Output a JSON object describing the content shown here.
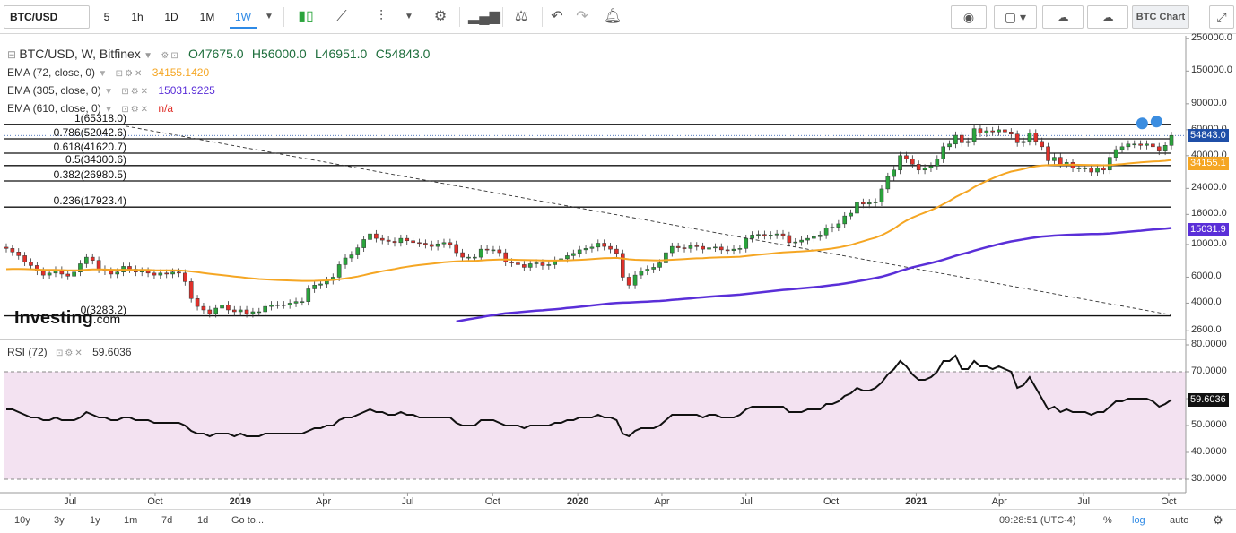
{
  "toolbar": {
    "symbol": "BTC/USD",
    "intervals": [
      "5",
      "1h",
      "1D",
      "1M",
      "1W"
    ],
    "active_interval": "1W",
    "chart_button": "BTC Chart"
  },
  "legend": {
    "title": "BTC/USD, W, Bitfinex",
    "open": "O47675.0",
    "high": "H56000.0",
    "low": "L46951.0",
    "close": "C54843.0",
    "ema72": {
      "label": "EMA (72, close, 0)",
      "value": "34155.1420",
      "color": "#f5a623"
    },
    "ema305": {
      "label": "EMA (305, close, 0)",
      "value": "15031.9225",
      "color": "#5a2fd8"
    },
    "ema610": {
      "label": "EMA (610, close, 0)",
      "value": "n/a",
      "color": "#e0302a"
    },
    "rsi": {
      "label": "RSI (72)",
      "value": "59.6036"
    }
  },
  "price_axis": [
    "250000.0",
    "150000.0",
    "90000.0",
    "60000.0",
    "40000.0",
    "24000.0",
    "16000.0",
    "10000.0",
    "6000.0",
    "4000.0",
    "2600.0"
  ],
  "rsi_axis": [
    "80.0000",
    "70.0000",
    "60.0000",
    "50.0000",
    "40.0000",
    "30.0000"
  ],
  "price_tags": {
    "last": "54843.0",
    "ema72": "34155.1",
    "ema305": "15031.9",
    "rsi": "59.6036"
  },
  "fib_levels": [
    {
      "label": "1(65318.0)",
      "price": 65318
    },
    {
      "label": "0.786(52042.6)",
      "price": 52042.6
    },
    {
      "label": "0.618(41620.7)",
      "price": 41620.7
    },
    {
      "label": "0.5(34300.6)",
      "price": 34300.6
    },
    {
      "label": "0.382(26980.5)",
      "price": 26980.5
    },
    {
      "label": "0.236(17923.4)",
      "price": 17923.4
    },
    {
      "label": "0(3283.2)",
      "price": 3283.2
    }
  ],
  "time_axis": [
    {
      "label": "Jul",
      "bold": false
    },
    {
      "label": "Oct",
      "bold": false
    },
    {
      "label": "2019",
      "bold": true
    },
    {
      "label": "Apr",
      "bold": false
    },
    {
      "label": "Jul",
      "bold": false
    },
    {
      "label": "Oct",
      "bold": false
    },
    {
      "label": "2020",
      "bold": true
    },
    {
      "label": "Apr",
      "bold": false
    },
    {
      "label": "Jul",
      "bold": false
    },
    {
      "label": "Oct",
      "bold": false
    },
    {
      "label": "2021",
      "bold": true
    },
    {
      "label": "Apr",
      "bold": false
    },
    {
      "label": "Jul",
      "bold": false
    },
    {
      "label": "Oct",
      "bold": false
    }
  ],
  "footer": {
    "ranges": [
      "10y",
      "3y",
      "1y",
      "1m",
      "7d",
      "1d",
      "Go to..."
    ],
    "time": "09:28:51 (UTC-4)",
    "percent": "%",
    "log": "log",
    "auto": "auto"
  },
  "logo": {
    "main": "Investing",
    "suffix": ".com"
  },
  "chart_data": {
    "type": "candlestick",
    "scale": "log",
    "ylim": [
      2300,
      260000
    ],
    "rsi_ylim": [
      25,
      82
    ],
    "x_range": [
      "2018-04-23",
      "2021-10-04"
    ],
    "close": [
      9400,
      8900,
      8400,
      7600,
      7200,
      6600,
      6200,
      6400,
      6700,
      6300,
      6100,
      6500,
      7400,
      8200,
      7800,
      6800,
      6600,
      6300,
      6500,
      7100,
      6800,
      6500,
      6600,
      6400,
      6200,
      6400,
      6300,
      6500,
      6400,
      5600,
      4300,
      3800,
      3600,
      3400,
      3700,
      3900,
      3600,
      3500,
      3600,
      3400,
      3500,
      3500,
      3800,
      3900,
      3900,
      3900,
      4000,
      4100,
      4100,
      5000,
      5300,
      5400,
      5700,
      6000,
      7300,
      8100,
      8500,
      9500,
      10800,
      11800,
      11000,
      10700,
      10500,
      10300,
      11000,
      10600,
      10300,
      10200,
      10000,
      9700,
      10100,
      10300,
      10000,
      8800,
      8200,
      8200,
      8200,
      9300,
      9200,
      9200,
      8800,
      7600,
      7500,
      7300,
      7000,
      7400,
      7500,
      7200,
      7300,
      7800,
      8000,
      8400,
      8700,
      9200,
      9400,
      9600,
      10200,
      9700,
      9300,
      8700,
      6000,
      5300,
      6200,
      6600,
      6800,
      7000,
      7500,
      8800,
      9700,
      9500,
      9400,
      9800,
      9700,
      9300,
      9500,
      9600,
      9200,
      9100,
      9300,
      9400,
      11000,
      11600,
      11700,
      11500,
      11600,
      11800,
      11500,
      10300,
      10400,
      10700,
      11000,
      11300,
      11600,
      12900,
      13100,
      13800,
      15600,
      16300,
      19300,
      18800,
      19200,
      19400,
      23800,
      28900,
      32000,
      40000,
      38000,
      35000,
      32000,
      33000,
      34000,
      38000,
      46000,
      48000,
      55000,
      49000,
      50000,
      61000,
      57000,
      59000,
      58000,
      60000,
      58000,
      56000,
      49000,
      50000,
      57000,
      50000,
      46000,
      37000,
      39000,
      35000,
      36000,
      33000,
      33000,
      33000,
      31000,
      33000,
      32000,
      39000,
      44000,
      46000,
      48000,
      48000,
      47000,
      48000,
      46000,
      43000,
      47000,
      54843
    ],
    "ema72": [
      6800,
      6820,
      6830,
      6810,
      6790,
      6760,
      6730,
      6720,
      6720,
      6710,
      6690,
      6680,
      6700,
      6740,
      6770,
      6770,
      6760,
      6740,
      6730,
      6740,
      6740,
      6730,
      6730,
      6720,
      6700,
      6690,
      6680,
      6680,
      6670,
      6640,
      6570,
      6490,
      6410,
      6330,
      6260,
      6200,
      6130,
      6060,
      6000,
      5940,
      5880,
      5830,
      5800,
      5770,
      5740,
      5720,
      5700,
      5680,
      5660,
      5660,
      5670,
      5690,
      5710,
      5750,
      5810,
      5880,
      5960,
      6060,
      6190,
      6340,
      6470,
      6590,
      6710,
      6820,
      6950,
      7060,
      7160,
      7250,
      7330,
      7410,
      7490,
      7570,
      7640,
      7680,
      7710,
      7730,
      7750,
      7800,
      7840,
      7880,
      7910,
      7900,
      7890,
      7870,
      7850,
      7830,
      7820,
      7800,
      7780,
      7780,
      7790,
      7800,
      7830,
      7870,
      7910,
      7960,
      8020,
      8060,
      8090,
      8110,
      8030,
      7930,
      7880,
      7850,
      7830,
      7810,
      7800,
      7830,
      7880,
      7920,
      7960,
      8010,
      8050,
      8080,
      8120,
      8160,
      8180,
      8200,
      8230,
      8260,
      8340,
      8430,
      8520,
      8600,
      8680,
      8760,
      8840,
      8880,
      8930,
      8980,
      9040,
      9110,
      9180,
      9290,
      9400,
      9540,
      9730,
      9930,
      10230,
      10520,
      10830,
      11130,
      11560,
      12140,
      12800,
      13700,
      14520,
      15230,
      15850,
      16470,
      17090,
      17830,
      18780,
      19760,
      20970,
      22010,
      23050,
      24490,
      25700,
      26930,
      28070,
      29230,
      30280,
      31240,
      31870,
      32520,
      33330,
      33910,
      34350,
      34480,
      34640,
      34690,
      34750,
      34720,
      34690,
      34660,
      34570,
      34530,
      34450,
      34570,
      34810,
      35090,
      35420,
      35730,
      36020,
      36340,
      36560,
      36700,
      36960,
      37420
    ],
    "ema305": [
      null,
      null,
      null,
      null,
      null,
      null,
      null,
      null,
      null,
      null,
      null,
      null,
      null,
      null,
      null,
      null,
      null,
      null,
      null,
      null,
      null,
      null,
      null,
      null,
      null,
      null,
      null,
      null,
      null,
      null,
      null,
      null,
      null,
      null,
      null,
      null,
      null,
      null,
      null,
      null,
      null,
      null,
      null,
      null,
      null,
      null,
      null,
      null,
      null,
      null,
      null,
      null,
      null,
      null,
      null,
      null,
      null,
      null,
      null,
      null,
      null,
      null,
      null,
      null,
      null,
      null,
      null,
      null,
      null,
      null,
      null,
      null,
      null,
      3000,
      3060,
      3110,
      3160,
      3210,
      3270,
      3320,
      3370,
      3410,
      3440,
      3470,
      3500,
      3530,
      3560,
      3580,
      3610,
      3640,
      3670,
      3710,
      3740,
      3780,
      3820,
      3860,
      3900,
      3940,
      3980,
      4010,
      4030,
      4040,
      4060,
      4080,
      4100,
      4120,
      4140,
      4170,
      4210,
      4240,
      4280,
      4310,
      4350,
      4380,
      4420,
      4450,
      4480,
      4510,
      4540,
      4570,
      4620,
      4670,
      4720,
      4770,
      4820,
      4870,
      4920,
      4960,
      5000,
      5040,
      5090,
      5130,
      5180,
      5240,
      5300,
      5360,
      5440,
      5520,
      5620,
      5720,
      5820,
      5920,
      6050,
      6210,
      6390,
      6610,
      6810,
      7000,
      7160,
      7320,
      7490,
      7670,
      7890,
      8120,
      8380,
      8600,
      8820,
      9090,
      9330,
      9570,
      9800,
      10040,
      10270,
      10490,
      10660,
      10830,
      11020,
      11180,
      11320,
      11400,
      11490,
      11550,
      11610,
      11650,
      11690,
      11730,
      11760,
      11790,
      11820,
      11880,
      11980,
      12080,
      12190,
      12300,
      12400,
      12510,
      12610,
      12700,
      12800,
      12940
    ],
    "rsi": [
      56,
      56,
      55,
      54,
      53,
      53,
      52,
      52,
      53,
      52,
      52,
      52,
      53,
      55,
      54,
      53,
      53,
      52,
      52,
      53,
      53,
      52,
      52,
      52,
      51,
      51,
      51,
      51,
      51,
      50,
      48,
      47,
      47,
      46,
      47,
      47,
      47,
      46,
      47,
      46,
      46,
      46,
      47,
      47,
      47,
      47,
      47,
      47,
      47,
      48,
      49,
      49,
      50,
      50,
      52,
      53,
      53,
      54,
      55,
      56,
      55,
      55,
      54,
      54,
      55,
      54,
      54,
      53,
      53,
      53,
      53,
      53,
      53,
      51,
      50,
      50,
      50,
      52,
      52,
      52,
      51,
      50,
      50,
      50,
      49,
      50,
      50,
      50,
      50,
      51,
      51,
      52,
      52,
      53,
      53,
      53,
      54,
      53,
      53,
      52,
      47,
      46,
      48,
      49,
      49,
      49,
      50,
      52,
      54,
      54,
      54,
      54,
      54,
      53,
      54,
      54,
      53,
      53,
      53,
      54,
      56,
      57,
      57,
      57,
      57,
      57,
      57,
      55,
      55,
      55,
      56,
      56,
      56,
      58,
      58,
      59,
      61,
      62,
      64,
      63,
      63,
      64,
      66,
      69,
      71,
      74,
      72,
      69,
      67,
      67,
      68,
      70,
      74,
      74,
      76,
      71,
      71,
      74,
      72,
      72,
      71,
      72,
      71,
      70,
      64,
      65,
      68,
      64,
      60,
      56,
      57,
      55,
      56,
      55,
      55,
      55,
      54,
      55,
      55,
      57,
      59,
      59,
      60,
      60,
      60,
      60,
      59,
      57,
      58,
      59.6
    ]
  }
}
